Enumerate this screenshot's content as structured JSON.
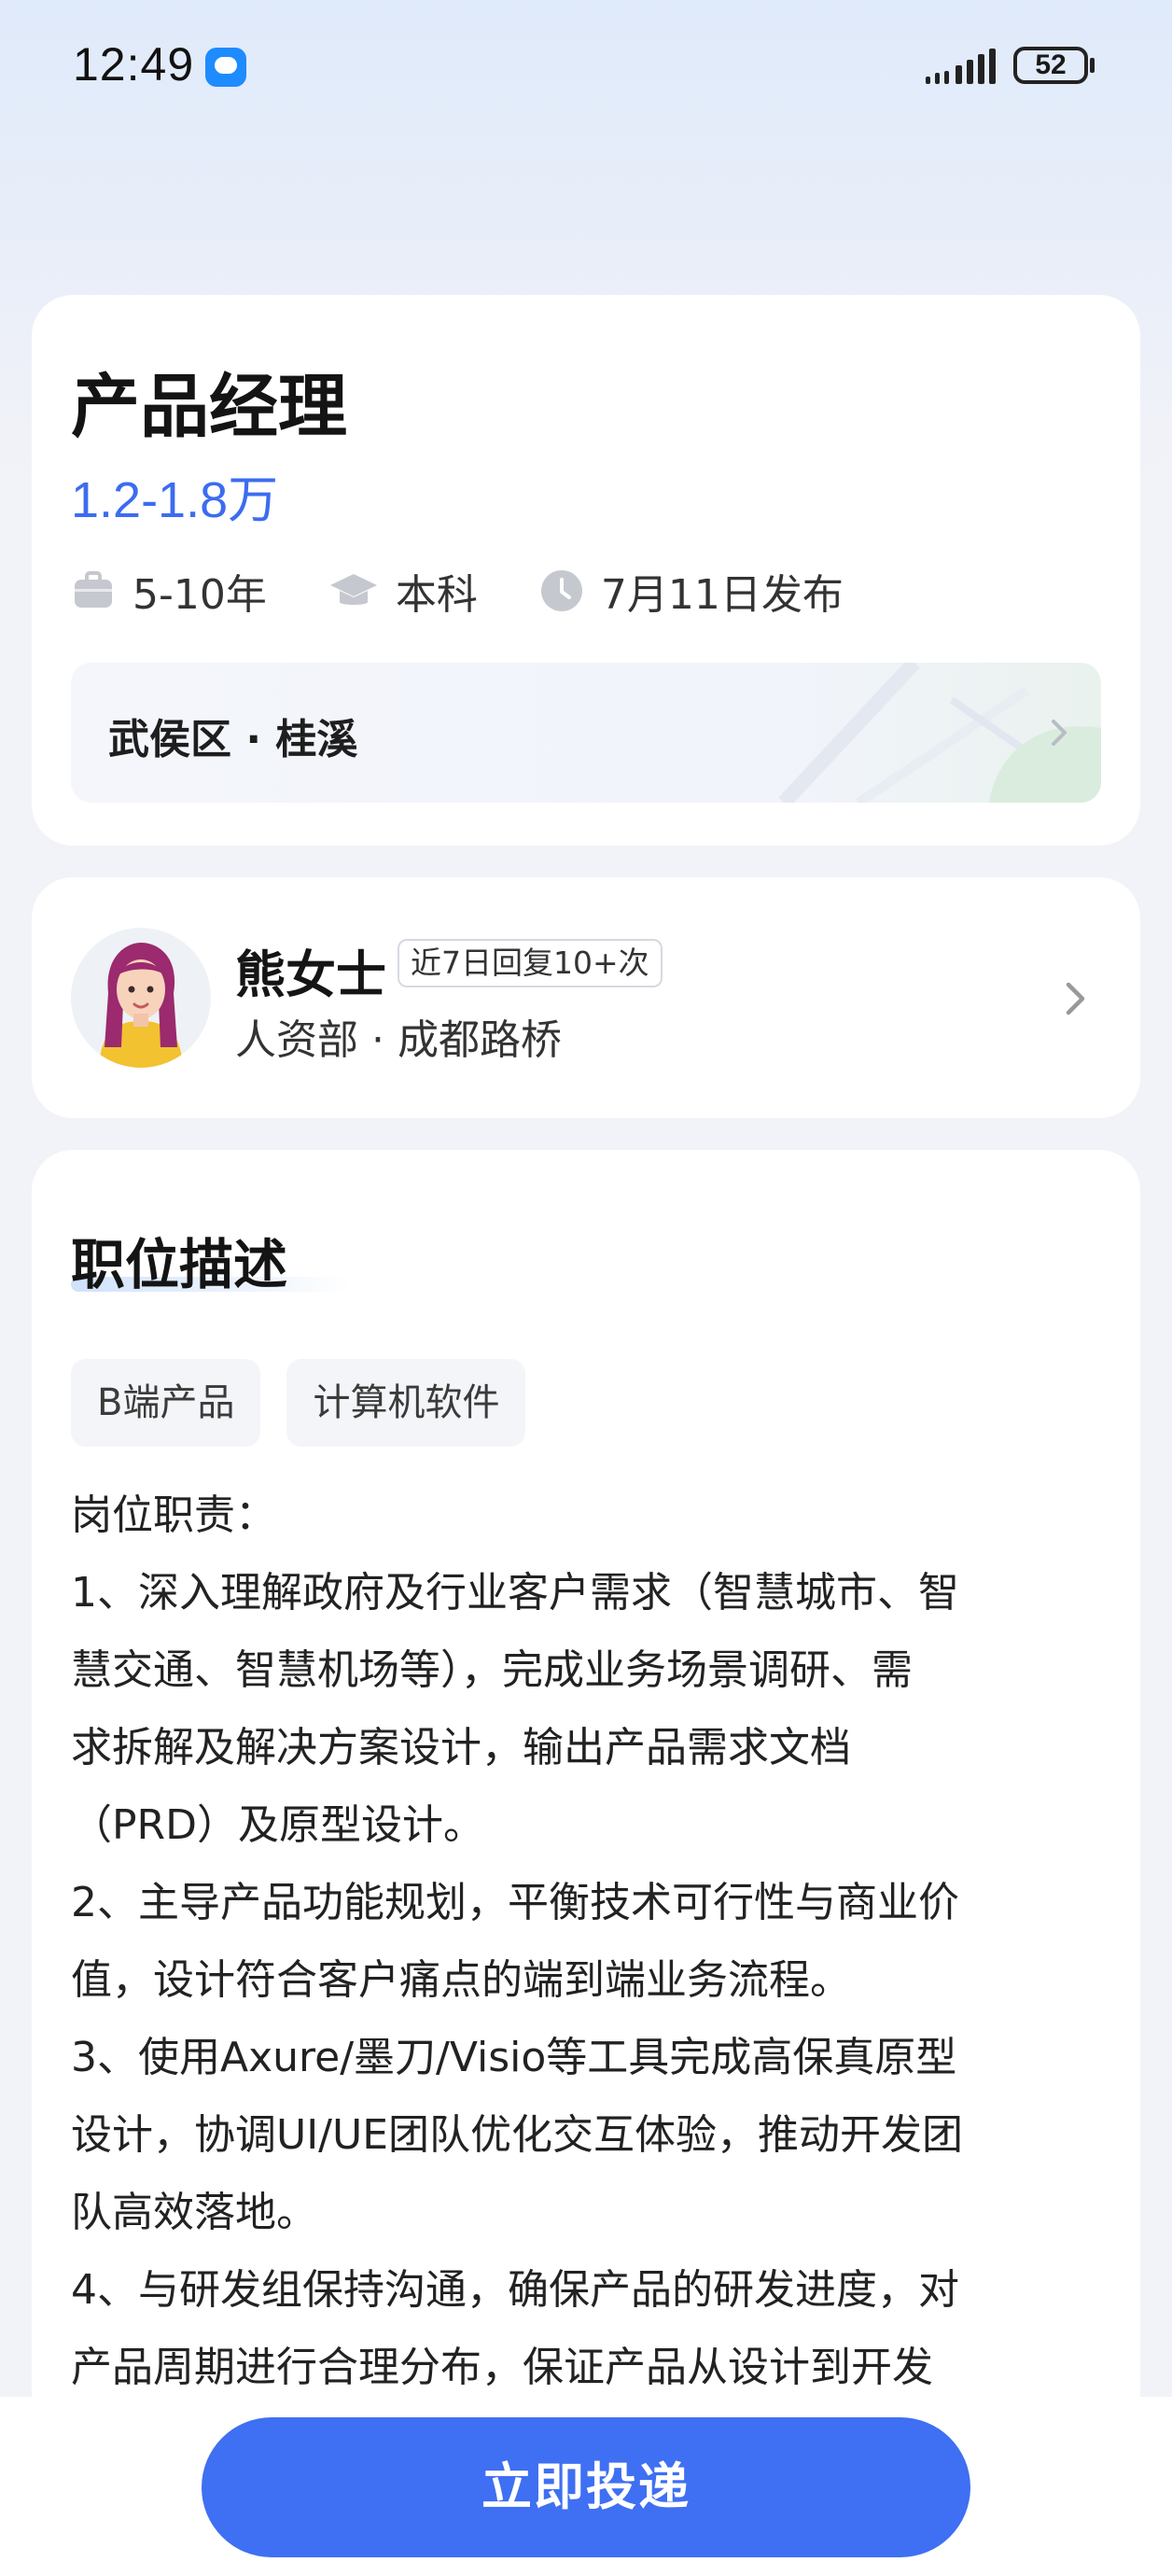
{
  "status_bar": {
    "time": "12:49",
    "battery": "52"
  },
  "job": {
    "title": "产品经理",
    "salary": "1.2-1.8万",
    "experience": "5-10年",
    "education": "本科",
    "posted": "7月11日发布",
    "location": "武侯区 · 桂溪"
  },
  "recruiter": {
    "name": "熊女士",
    "reply_badge": "近7日回复10+次",
    "department": "人资部 · 成都路桥"
  },
  "description": {
    "title": "职位描述",
    "tags": [
      "B端产品",
      "计算机软件"
    ],
    "lines": [
      "岗位职责：",
      "1、深入理解政府及行业客户需求（智慧城市、智",
      "慧交通、智慧机场等），完成业务场景调研、需",
      "求拆解及解决方案设计，输出产品需求文档",
      "（PRD）及原型设计。",
      "2、主导产品功能规划，平衡技术可行性与商业价",
      "值，设计符合客户痛点的端到端业务流程。",
      "3、使用Axure/墨刀/Visio等工具完成高保真原型",
      "设计，协调UI/UE团队优化交互体验，推动开发团",
      "队高效落地。",
      "4、与研发组保持沟通，确保产品的研发进度，对",
      "产品周期进行合理分布，保证产品从设计到开发"
    ]
  },
  "actions": {
    "apply": "立即投递"
  },
  "icons": {
    "back": "back-arrow-icon",
    "share": "share-icon",
    "favorite": "star-icon",
    "more": "more-dots-icon",
    "experience": "briefcase-icon",
    "education": "graduation-cap-icon",
    "posted": "clock-icon"
  },
  "colors": {
    "accent": "#3f6ff2",
    "salary": "#3c6cf0"
  }
}
